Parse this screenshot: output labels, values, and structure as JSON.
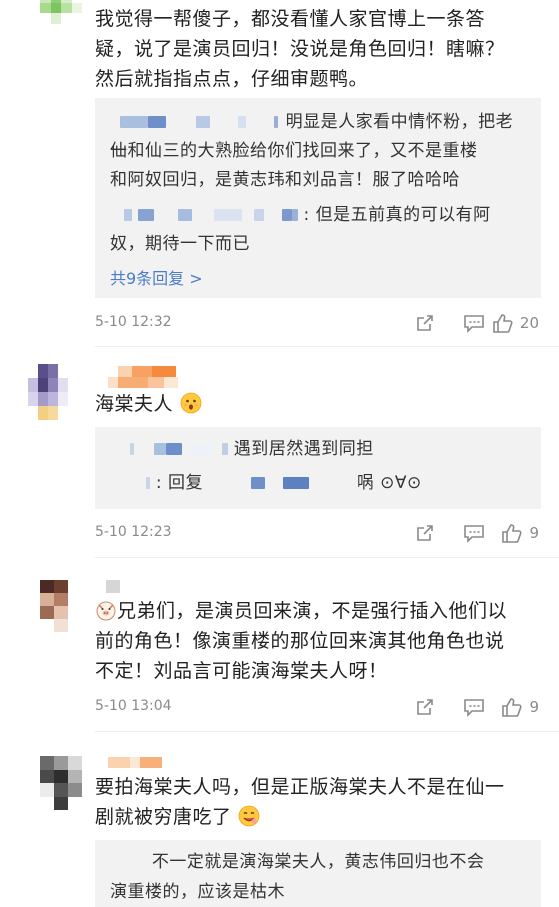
{
  "comments": [
    {
      "text_lines": [
        "我觉得一帮傻子，都没看懂人家官博上一条答",
        "疑，说了是演员回归！没说是角色回归！瞎嘛？",
        "然后就指指点点，仔细审题鸭。"
      ],
      "replies": [
        {
          "lines": [
            "明显是人家看中情怀粉，把老仙",
            "一和仙三的大熟脸给你们找回来了，又不是重楼",
            "和阿奴回归，是黄志玮和刘品言！服了哈哈哈"
          ]
        },
        {
          "lines": [
            ": 但是五前真的可以有阿",
            "奴，期待一下而已"
          ]
        }
      ],
      "more_replies": "共9条回复 >",
      "time": "5-10 12:32",
      "likes": "20"
    },
    {
      "text": "海棠夫人",
      "replies": [
        {
          "lines": [
            "遇到居然遇到同担"
          ]
        },
        {
          "lines": [
            ": 回复",
            "㖞 ⊙∀⊙"
          ]
        }
      ],
      "time": "5-10 12:23",
      "likes": "9"
    },
    {
      "text_lines": [
        "兄弟们，是演员回来演，不是强行插入他们以",
        "前的角色！像演重楼的那位回来演其他角色也说",
        "不定！刘品言可能演海棠夫人呀！"
      ],
      "time": "5-10 13:04",
      "likes": "9"
    },
    {
      "text_lines": [
        "要拍海棠夫人吗，但是正版海棠夫人不是在仙一",
        "剧就被穷唐吃了"
      ],
      "replies": [
        {
          "lines": [
            "不一定就是演海棠夫人，黄志伟回归也不会",
            "演重楼的，应该是枯木"
          ]
        }
      ]
    }
  ],
  "icons": {
    "forward": "forward-icon",
    "comment": "comment-icon",
    "like": "thumbs-up-icon"
  },
  "colors": {
    "link": "#4a7cc9",
    "meta": "#8a8a8a",
    "reply_bg": "#f2f2f2"
  }
}
